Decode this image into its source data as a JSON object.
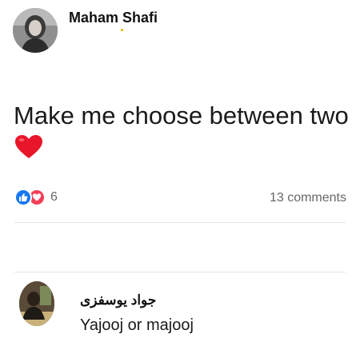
{
  "post": {
    "author": "Maham Shafi",
    "text": "Make me choose between two",
    "emoji": "heart-emoji",
    "reactions": {
      "count": "6",
      "types": [
        "like",
        "love"
      ]
    },
    "comments_label": "13 comments"
  },
  "comment": {
    "author": "جواد یوسفزی",
    "text": "Yajooj or majooj"
  },
  "colors": {
    "like": "#1877f2",
    "love": "#f33e58",
    "heart": "#e8162b",
    "muted_text": "#65676b"
  }
}
